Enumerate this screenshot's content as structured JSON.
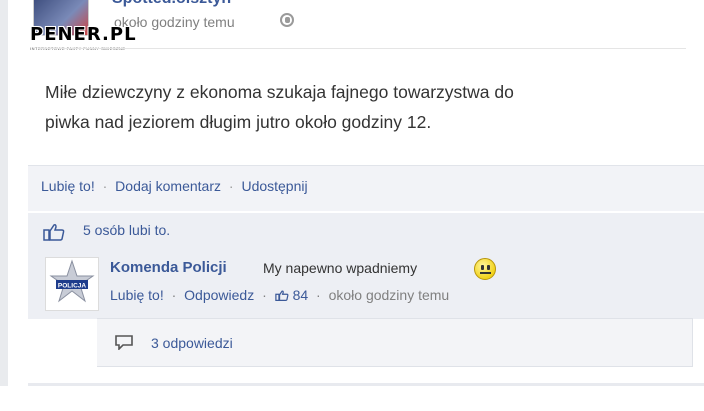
{
  "post": {
    "page_name": "Spotted.olsztyn",
    "time": "około godziny temu",
    "watermark": "PENER.PL",
    "watermark_sub": "INTERNETOWE FAKTY FUNNY SMIESZNE",
    "text_line1": "Miłe dziewczyny z ekonoma szukaja fajnego towarzystwa do",
    "text_line2": "piwka nad jeziorem długim jutro około godziny 12."
  },
  "actions": {
    "like": "Lubię to!",
    "comment": "Dodaj komentarz",
    "share": "Udostępnij",
    "separator": "·"
  },
  "likes": {
    "text": "5 osób lubi to."
  },
  "comment": {
    "author": "Komenda Policji",
    "text": "My napewno wpadniemy",
    "like": "Lubię to!",
    "reply": "Odpowiedz",
    "like_count": "84",
    "time": "około godziny temu",
    "avatar_text": "POLICJA"
  },
  "replies": {
    "text": "3 odpowiedzi"
  },
  "colors": {
    "link": "#3b5998",
    "bar_bg": "#edeff4"
  }
}
